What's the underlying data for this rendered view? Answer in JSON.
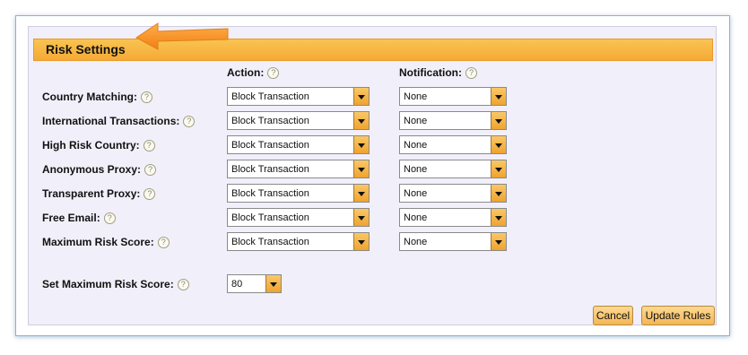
{
  "header": {
    "title": "Risk Settings"
  },
  "columns": {
    "action": "Action:",
    "notification": "Notification:"
  },
  "rows": [
    {
      "label": "Country Matching:",
      "action": "Block Transaction",
      "notification": "None"
    },
    {
      "label": "International Transactions:",
      "action": "Block Transaction",
      "notification": "None"
    },
    {
      "label": "High Risk Country:",
      "action": "Block Transaction",
      "notification": "None"
    },
    {
      "label": "Anonymous Proxy:",
      "action": "Block Transaction",
      "notification": "None"
    },
    {
      "label": "Transparent Proxy:",
      "action": "Block Transaction",
      "notification": "None"
    },
    {
      "label": "Free Email:",
      "action": "Block Transaction",
      "notification": "None"
    },
    {
      "label": "Maximum Risk Score:",
      "action": "Block Transaction",
      "notification": "None"
    }
  ],
  "max_score": {
    "label": "Set Maximum Risk Score:",
    "value": "80"
  },
  "buttons": {
    "cancel": "Cancel",
    "update": "Update Rules"
  },
  "help_glyph": "?",
  "colors": {
    "accent": "#f5a936",
    "panel": "#f1eff9",
    "arrow": "#f7941e",
    "border": "#8fb1cc"
  },
  "icons": {
    "help": "question-circle-icon",
    "dropdown": "chevron-down-icon",
    "pointer": "arrow-left-icon"
  }
}
